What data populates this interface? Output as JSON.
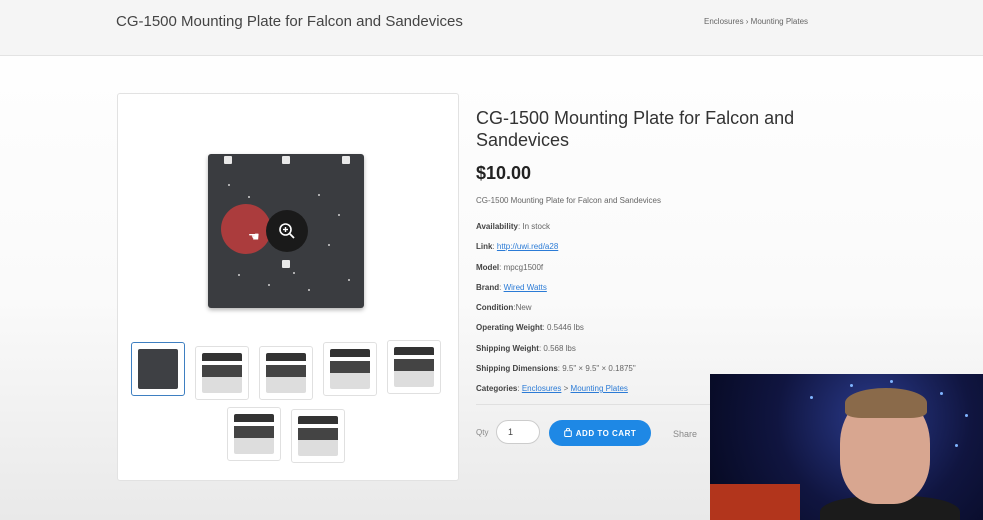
{
  "header": {
    "title": "CG-1500 Mounting Plate for Falcon and Sandevices",
    "breadcrumb": "Enclosures › Mounting Plates"
  },
  "product": {
    "title": "CG-1500 Mounting Plate for Falcon and Sandevices",
    "price": "$10.00",
    "description": "CG-1500 Mounting Plate for Falcon and Sandevices",
    "availability_label": "Availability",
    "availability_value": "In stock",
    "link_label": "Link",
    "link_value": "http://uwi.red/a28",
    "model_label": "Model",
    "model_value": "mpcg1500f",
    "brand_label": "Brand",
    "brand_value": "Wired Watts",
    "condition_label": "Condition",
    "condition_value": "New",
    "op_weight_label": "Operating Weight",
    "op_weight_value": "0.5446 lbs",
    "ship_weight_label": "Shipping Weight",
    "ship_weight_value": "0.568 lbs",
    "ship_dim_label": "Shipping Dimensions",
    "ship_dim_value": "9.5\" × 9.5\" × 0.1875\"",
    "categories_label": "Categories",
    "category_1": "Enclosures",
    "category_sep": ">",
    "category_2": "Mounting Plates"
  },
  "purchase": {
    "qty_label": "Qty",
    "qty_value": "1",
    "add_to_cart": "ADD TO CART",
    "share": "Share"
  },
  "colors": {
    "accent": "#1e88e5",
    "link": "#2b7bd6"
  },
  "icons": [
    "zoom-in-icon",
    "hand-cursor-icon",
    "bag-icon"
  ]
}
